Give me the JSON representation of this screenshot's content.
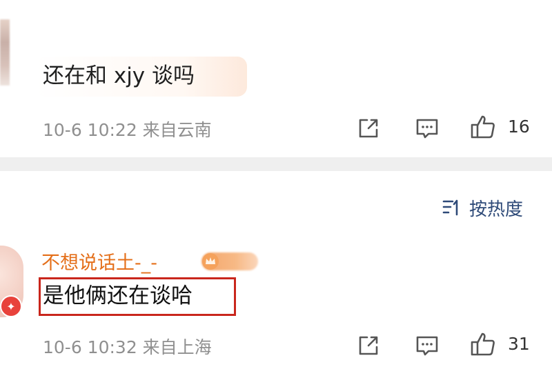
{
  "comments": [
    {
      "text": "还在和 xjy 谈吗",
      "meta": "10-6 10:22  来自云南",
      "likes": "16"
    },
    {
      "username": "不想说话土-_-",
      "text": "是他俩还在谈哈",
      "meta": "10-6 10:32  来自上海",
      "likes": "31"
    }
  ],
  "sort": {
    "label": "按热度"
  },
  "icons": {
    "share": "share-icon",
    "comment": "comment-icon",
    "like": "thumbs-up-icon",
    "sort": "sort-icon",
    "vip": "vip-badge-icon",
    "crown": "crown-icon"
  },
  "colors": {
    "username": "#e46f1a",
    "sort_link": "#2e4a78",
    "highlight_border": "#c9261c",
    "meta_text": "#8f8f8f",
    "divider": "#efefef"
  }
}
